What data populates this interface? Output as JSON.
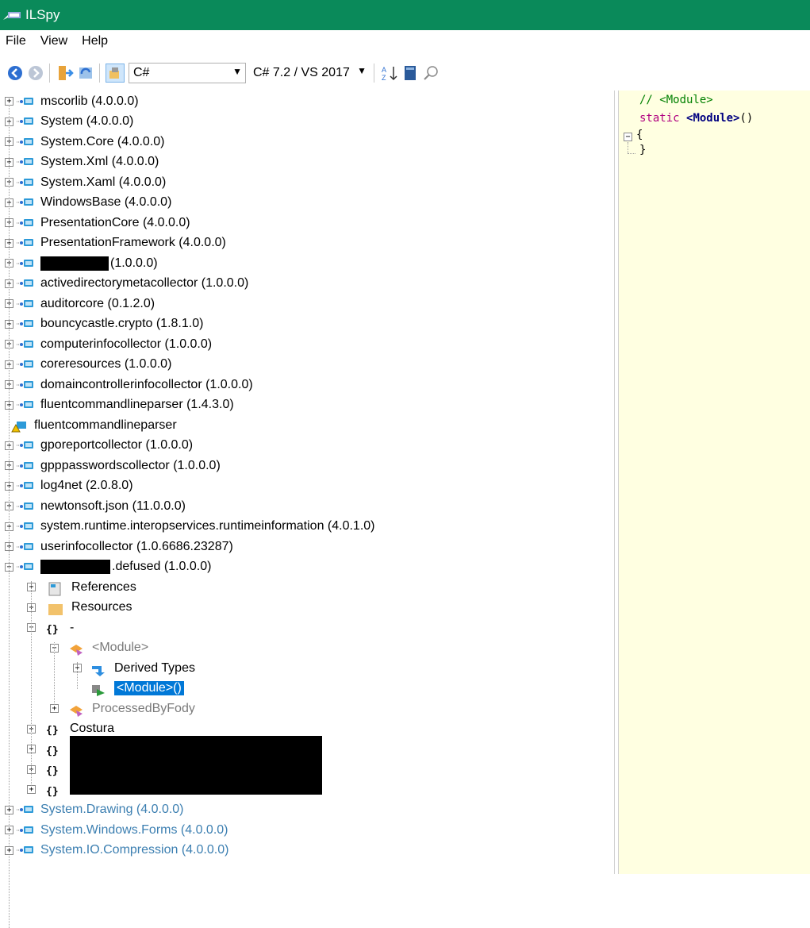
{
  "window": {
    "title": "ILSpy"
  },
  "menu": [
    "File",
    "View",
    "Help"
  ],
  "toolbar": {
    "language": "C#",
    "version": "C# 7.2 / VS 2017"
  },
  "tree": {
    "assemblies": [
      {
        "name": "mscorlib (4.0.0.0)"
      },
      {
        "name": "System (4.0.0.0)"
      },
      {
        "name": "System.Core (4.0.0.0)"
      },
      {
        "name": "System.Xml (4.0.0.0)"
      },
      {
        "name": "System.Xaml (4.0.0.0)"
      },
      {
        "name": "WindowsBase (4.0.0.0)"
      },
      {
        "name": "PresentationCore (4.0.0.0)"
      },
      {
        "name": "PresentationFramework (4.0.0.0)"
      },
      {
        "name": "(1.0.0.0)"
      },
      {
        "name": "activedirectorymetacollector (1.0.0.0)"
      },
      {
        "name": "auditorcore (0.1.2.0)"
      },
      {
        "name": "bouncycastle.crypto (1.8.1.0)"
      },
      {
        "name": "computerinfocollector (1.0.0.0)"
      },
      {
        "name": "coreresources (1.0.0.0)"
      },
      {
        "name": "domaincontrollerinfocollector (1.0.0.0)"
      },
      {
        "name": "fluentcommandlineparser (1.4.3.0)"
      },
      {
        "name": "fluentcommandlineparser"
      },
      {
        "name": "gporeportcollector (1.0.0.0)"
      },
      {
        "name": "gpppasswordscollector (1.0.0.0)"
      },
      {
        "name": "log4net (2.0.8.0)"
      },
      {
        "name": "newtonsoft.json (11.0.0.0)"
      },
      {
        "name": "system.runtime.interopservices.runtimeinformation (4.0.1.0)"
      },
      {
        "name": "userinfocollector (1.0.6686.23287)"
      },
      {
        "name": ".defused (1.0.0.0)"
      }
    ],
    "children": {
      "references": "References",
      "resources": "Resources",
      "ns_root": "-",
      "module": "<Module>",
      "derived_types": "Derived Types",
      "module_ctor": "<Module>()",
      "processed_by_fody": "ProcessedByFody",
      "costura": "Costura"
    },
    "tail_assemblies": [
      {
        "name": "System.Drawing (4.0.0.0)"
      },
      {
        "name": "System.Windows.Forms (4.0.0.0)"
      },
      {
        "name": "System.IO.Compression (4.0.0.0)"
      }
    ]
  },
  "code": {
    "comment": "// <Module>",
    "kw_static": "static",
    "ident": "<Module>",
    "parens": "()",
    "open": "{",
    "close": "}"
  },
  "colors": {
    "titlebar": "#0a8a5a",
    "code_bg": "#ffffe1",
    "selection": "#0078d7",
    "comment": "#008000",
    "keyword": "#b00080"
  }
}
